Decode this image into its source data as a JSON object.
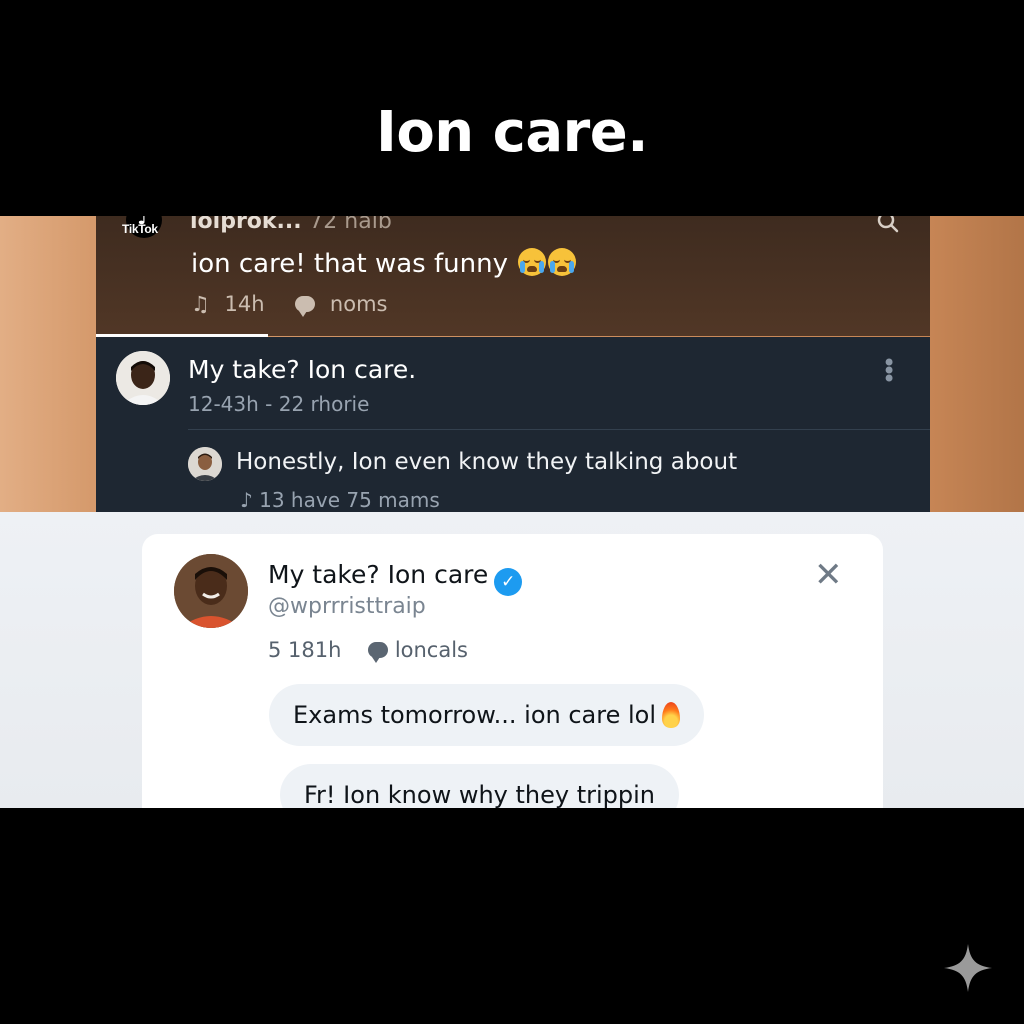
{
  "caption": "Ion care.",
  "tiktok": {
    "logo_text": "TikTok",
    "username": "ioiprok...",
    "username_meta": "72 naib",
    "comment": "ion care! that was funny",
    "comment_emojis": [
      "loudly-crying-face",
      "loudly-crying-face"
    ],
    "meta_time": "14h",
    "meta_label": "noms",
    "colors": {
      "panel": "#4a3222",
      "text": "#ffffff"
    }
  },
  "dark_thread": {
    "title": "My take? Ion care.",
    "subtitle": "12-43h - 22 rhorie",
    "reply_text": "Honestly, Ion even know they talking about",
    "reply_meta": "13 have 75 mams",
    "colors": {
      "panel": "#1e2732"
    }
  },
  "tweet_card": {
    "name": "My take? Ion care",
    "handle": "@wprrristtraip",
    "meta_time": "5 181h",
    "meta_label": "loncals",
    "replies": [
      {
        "text": "Exams tomorrow... ion care lol"
      },
      {
        "text": "Fr!   Ion know why they trippin"
      }
    ],
    "colors": {
      "verified": "#1d9bf0",
      "bubble": "#eef2f6"
    }
  }
}
